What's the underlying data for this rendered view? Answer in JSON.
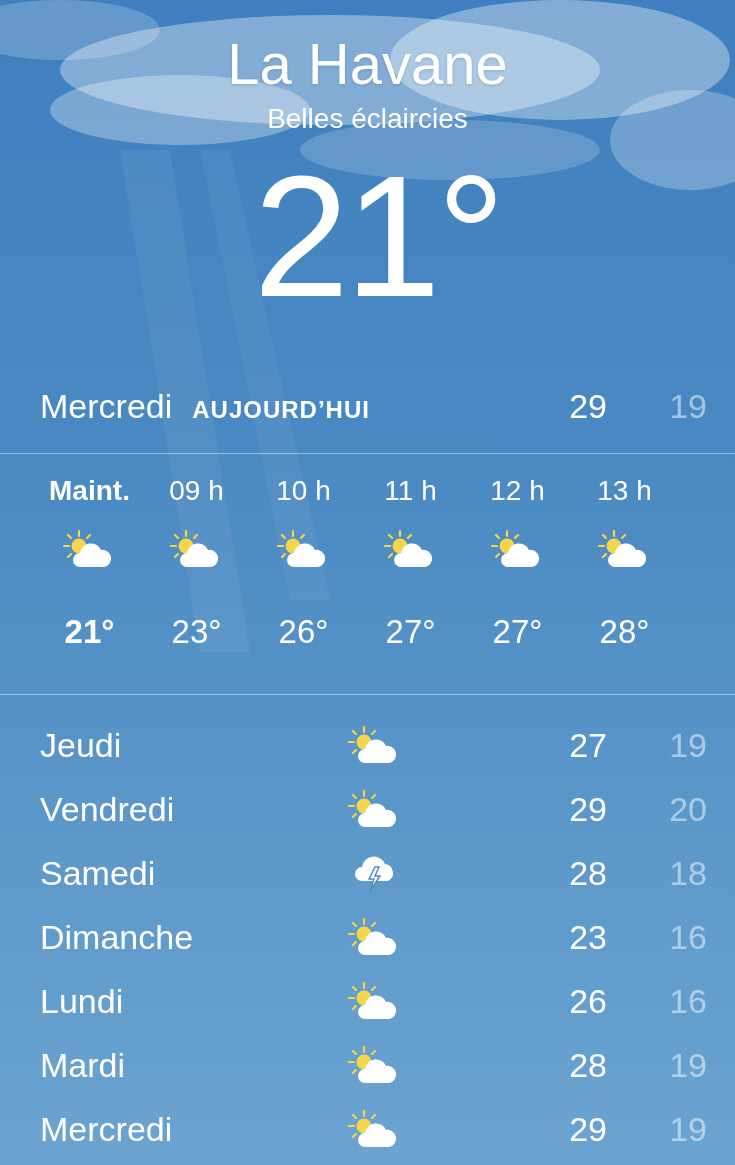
{
  "city": "La Havane",
  "condition": "Belles éclaircies",
  "temperature": "21°",
  "today": {
    "day": "Mercredi",
    "label": "AUJOURD’HUI",
    "high": "29",
    "low": "19"
  },
  "hourly": [
    {
      "time": "Maint.",
      "kind": "sun-cloud",
      "temp": "21°",
      "selected": true
    },
    {
      "time": "09 h",
      "kind": "sun-cloud",
      "temp": "23°",
      "selected": false
    },
    {
      "time": "10 h",
      "kind": "sun-cloud",
      "temp": "26°",
      "selected": false
    },
    {
      "time": "11 h",
      "kind": "sun-cloud",
      "temp": "27°",
      "selected": false
    },
    {
      "time": "12 h",
      "kind": "sun-cloud",
      "temp": "27°",
      "selected": false
    },
    {
      "time": "13 h",
      "kind": "sun-cloud",
      "temp": "28°",
      "selected": false
    }
  ],
  "daily": [
    {
      "day": "Jeudi",
      "kind": "sun-cloud",
      "high": "27",
      "low": "19"
    },
    {
      "day": "Vendredi",
      "kind": "sun-cloud",
      "high": "29",
      "low": "20"
    },
    {
      "day": "Samedi",
      "kind": "storm",
      "high": "28",
      "low": "18"
    },
    {
      "day": "Dimanche",
      "kind": "sun-cloud",
      "high": "23",
      "low": "16"
    },
    {
      "day": "Lundi",
      "kind": "sun-cloud",
      "high": "26",
      "low": "16"
    },
    {
      "day": "Mardi",
      "kind": "sun-cloud",
      "high": "28",
      "low": "19"
    },
    {
      "day": "Mercredi",
      "kind": "sun-cloud",
      "high": "29",
      "low": "19"
    }
  ]
}
